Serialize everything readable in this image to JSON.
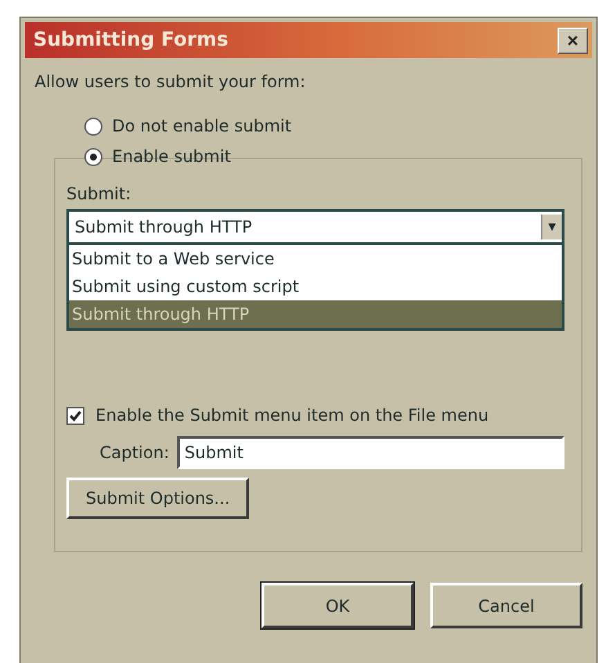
{
  "window": {
    "title": "Submitting Forms",
    "close": "×"
  },
  "intro": "Allow users to submit your form:",
  "options": [
    {
      "label": "Do not enable submit",
      "selected": false
    },
    {
      "label": "Enable submit",
      "selected": true
    }
  ],
  "submit": {
    "label": "Submit:",
    "value": "Submit through HTTP",
    "arrow": "▾",
    "expanded": true,
    "items": [
      {
        "label": "Submit to a Web service",
        "selected": false
      },
      {
        "label": "Submit using custom script",
        "selected": false
      },
      {
        "label": "Submit through HTTP",
        "selected": true
      }
    ]
  },
  "menu_item": {
    "label": "Enable the Submit menu item on the File menu",
    "checked": true
  },
  "caption": {
    "label": "Caption:",
    "value": "Submit"
  },
  "options_button": "Submit Options...",
  "buttons": [
    "OK",
    "Cancel"
  ]
}
